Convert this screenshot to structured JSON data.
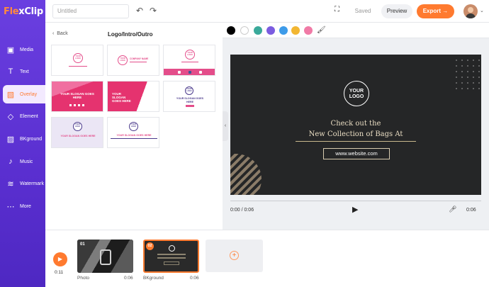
{
  "app": {
    "name_part1": "Fle",
    "name_part2": "xClip"
  },
  "topbar": {
    "title_placeholder": "Untitled",
    "undo_icon": "undo-icon",
    "redo_icon": "redo-icon",
    "saved_label": "Saved",
    "preview_label": "Preview",
    "export_label": "Export →"
  },
  "sidebar": {
    "items": [
      {
        "label": "Media",
        "icon": "media-icon",
        "glyph": "▣"
      },
      {
        "label": "Text",
        "icon": "text-icon",
        "glyph": "T"
      },
      {
        "label": "Overlay",
        "icon": "overlay-icon",
        "glyph": "▧"
      },
      {
        "label": "Element",
        "icon": "element-icon",
        "glyph": "◇"
      },
      {
        "label": "BKground",
        "icon": "background-icon",
        "glyph": "▨"
      },
      {
        "label": "Music",
        "icon": "music-icon",
        "glyph": "♪"
      },
      {
        "label": "Watermark",
        "icon": "watermark-icon",
        "glyph": "≋"
      },
      {
        "label": "More",
        "icon": "more-icon",
        "glyph": "⋯"
      }
    ],
    "active": "Overlay"
  },
  "panel": {
    "back_label": "Back",
    "title": "Logo/Intro/Outro",
    "templates": [
      {
        "logo": "YOUR LOGO"
      },
      {
        "logo": "YOUR LOGO",
        "text": "COMPANY NAME"
      },
      {
        "logo": "YOUR LOGO"
      },
      {
        "text": "YOUR SLOGAN GOES HERE"
      },
      {
        "text": "YOUR SLOGAN GOES HERE"
      },
      {
        "logo": "YOUR LOGO",
        "text": "YOUR SLOGAN GOES HERE"
      },
      {
        "logo": "YOUR LOGO",
        "text": "YOUR SLOGAN GOES HERE"
      },
      {
        "logo": "YOUR LOGO",
        "text": "YOUR SLOGAN GOES HERE"
      }
    ]
  },
  "colors": [
    "#000000",
    "#ffffff",
    "#3aa99a",
    "#7b5ce0",
    "#3d9be9",
    "#f2b632",
    "#f07aa6"
  ],
  "stage": {
    "logo_line1": "YOUR",
    "logo_line2": "LOGO",
    "headline1": "Check out the",
    "headline2": "New Collection of Bags At",
    "website": "www.website.com"
  },
  "player": {
    "current": "0:00 / 0:06",
    "duration": "0:06"
  },
  "timeline": {
    "total_time": "0:11",
    "clips": [
      {
        "num": "01",
        "label": "Photo",
        "duration": "0:06"
      },
      {
        "num": "02",
        "label": "BKground",
        "duration": "0:06"
      }
    ]
  }
}
